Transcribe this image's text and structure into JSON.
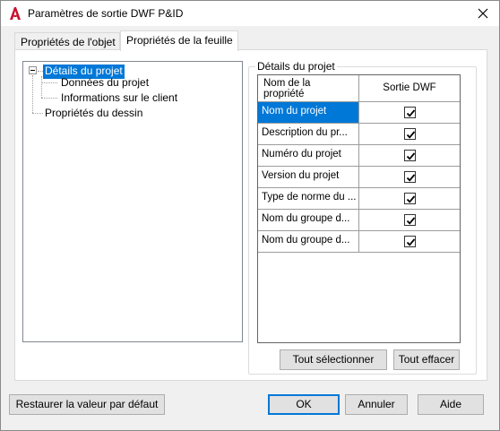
{
  "window": {
    "title": "Paramètres de sortie DWF P&ID",
    "app_icon": "autocad-a-icon",
    "close_icon": "close-icon"
  },
  "tabs": [
    {
      "label": "Propriétés de l'objet",
      "active": false
    },
    {
      "label": "Propriétés de la feuille",
      "active": true
    }
  ],
  "tree": {
    "nodes": [
      {
        "label": "Détails du projet",
        "selected": true
      },
      {
        "label": "Données du projet"
      },
      {
        "label": "Informations sur le client"
      },
      {
        "label": "Propriétés du dessin"
      }
    ]
  },
  "details": {
    "group_title": "Détails du projet",
    "columns": [
      "Nom de la propriété",
      "Sortie DWF"
    ],
    "column_name_line1": "Nom de la",
    "column_name_line2": "propriété",
    "rows": [
      {
        "name": "Nom du projet",
        "checked": true,
        "selected": true
      },
      {
        "name": "Description du pr...",
        "checked": true
      },
      {
        "name": "Numéro du projet",
        "checked": true
      },
      {
        "name": "Version du projet",
        "checked": true
      },
      {
        "name": "Type de norme du ...",
        "checked": true
      },
      {
        "name": "Nom du groupe d...",
        "checked": true
      },
      {
        "name": "Nom du groupe d...",
        "checked": true
      }
    ],
    "select_all_label": "Tout sélectionner",
    "clear_all_label": "Tout effacer"
  },
  "footer": {
    "restore_label": "Restaurer la valeur par défaut",
    "ok_label": "OK",
    "cancel_label": "Annuler",
    "help_label": "Aide"
  },
  "colors": {
    "selection": "#0078d7",
    "app_icon": "#c8102e"
  }
}
